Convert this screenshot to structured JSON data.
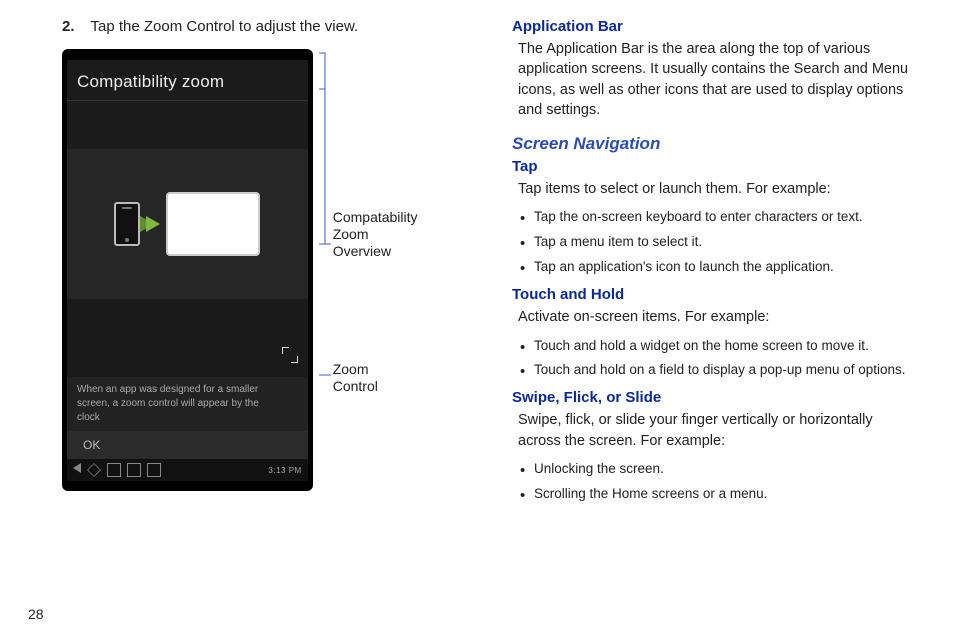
{
  "page_number": "28",
  "left": {
    "step_number": "2.",
    "step_text": "Tap the Zoom Control to adjust the view.",
    "phone": {
      "header": "Compatibility zoom",
      "info_text": "When an app was designed for a smaller screen, a zoom control will appear by the clock",
      "ok_label": "OK",
      "status_time": "3:13 PM"
    },
    "callouts": {
      "overview": "Compatability\nZoom\nOverview",
      "zoom_control": "Zoom\nControl"
    }
  },
  "right": {
    "app_bar": {
      "heading": "Application Bar",
      "body": "The Application Bar is the area along the top of various application screens. It usually contains the Search and Menu icons, as well as other icons that are used to display options and settings."
    },
    "section_heading": "Screen Navigation",
    "tap": {
      "heading": "Tap",
      "intro": "Tap items to select or launch them. For example:",
      "items": [
        "Tap the on-screen keyboard to enter characters or text.",
        "Tap a menu item to select it.",
        "Tap an application's icon to launch the application."
      ]
    },
    "touch_hold": {
      "heading": "Touch and Hold",
      "intro": "Activate on-screen items. For example:",
      "items": [
        "Touch and hold a widget on the home screen to move it.",
        "Touch and hold on a field to display a pop-up menu of options."
      ]
    },
    "swipe": {
      "heading": "Swipe, Flick, or Slide",
      "intro": "Swipe, flick, or slide your finger vertically or horizontally across the screen. For example:",
      "items": [
        "Unlocking the screen.",
        "Scrolling the Home screens or a menu."
      ]
    }
  }
}
